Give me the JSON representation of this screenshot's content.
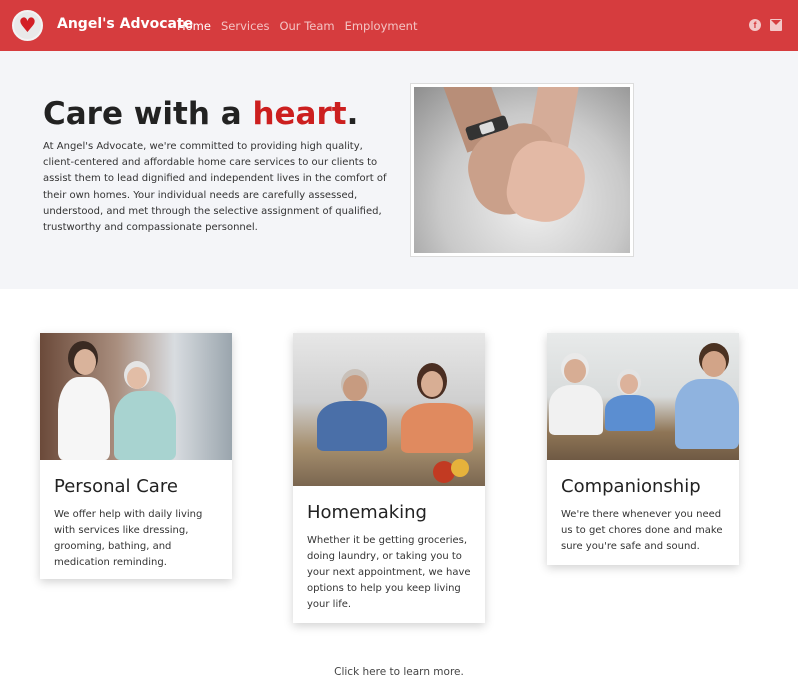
{
  "navbar": {
    "brand": "Angel's Advocate",
    "links": [
      {
        "label": "Home",
        "active": true
      },
      {
        "label": "Services",
        "active": false
      },
      {
        "label": "Our Team",
        "active": false
      },
      {
        "label": "Employment",
        "active": false
      }
    ],
    "icons": [
      "facebook-icon",
      "envelope-icon"
    ],
    "background_color": "#d63c3e"
  },
  "hero": {
    "title_part1": "Care with a ",
    "title_accent": "heart",
    "title_end": ".",
    "accent_color": "#cc1f1f",
    "text": "At Angel's Advocate, we're committed to providing high quality, client-centered and affordable home care services to our clients to assist them to lead dignified and independent lives in the comfort of their own homes. Your individual needs are carefully assessed, understood, and met through the selective assignment of qualified, trustworthy and compassionate personnel."
  },
  "cards": [
    {
      "title": "Personal Care",
      "text": "We offer help with daily living with services like dressing, grooming, bathing, and medication reminding."
    },
    {
      "title": "Homemaking",
      "text": "Whether it be getting groceries, doing laundry, or taking you to your next appointment, we have options to help you keep living your life."
    },
    {
      "title": "Companionship",
      "text": "We're there whenever you need us to get chores done and make sure you're safe and sound."
    }
  ],
  "footer": {
    "learn_more": "Click here to learn more."
  }
}
